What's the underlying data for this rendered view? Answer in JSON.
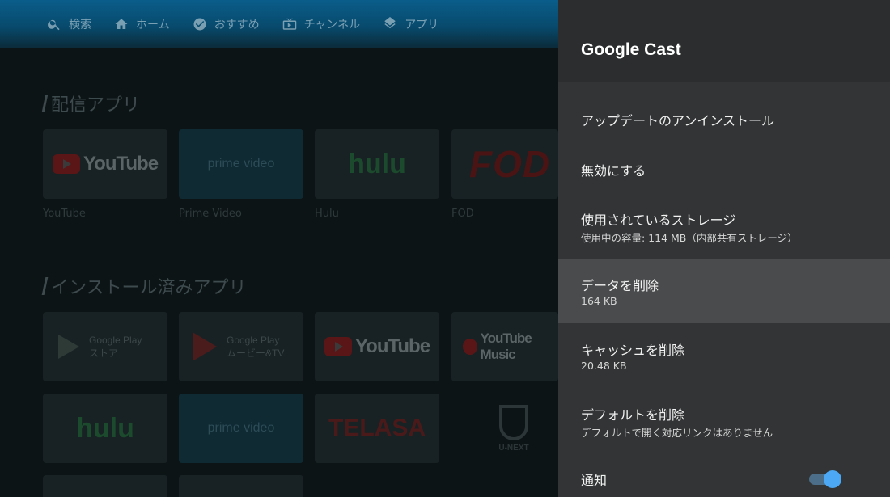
{
  "launcher": {
    "nav": [
      {
        "label": "検索",
        "icon": "search-icon"
      },
      {
        "label": "ホーム",
        "icon": "home-icon"
      },
      {
        "label": "おすすめ",
        "icon": "check-circle-icon"
      },
      {
        "label": "チャンネル",
        "icon": "tv-icon"
      },
      {
        "label": "アプリ",
        "icon": "layers-icon"
      }
    ],
    "sections": {
      "streaming_title": "配信アプリ",
      "installed_title": "インストール済みアプリ"
    },
    "streaming_apps": [
      {
        "logo": "YouTube",
        "caption": "YouTube"
      },
      {
        "logo": "prime video",
        "caption": "Prime Video"
      },
      {
        "logo": "hulu",
        "caption": "Hulu"
      },
      {
        "logo": "FOD",
        "caption": "FOD"
      }
    ],
    "installed_apps": [
      {
        "logo": "Google Play ストア"
      },
      {
        "logo": "Google Play ムービー&TV"
      },
      {
        "logo": "YouTube"
      },
      {
        "logo": "YouTube Music"
      },
      {
        "logo": "hulu"
      },
      {
        "logo": "prime video"
      },
      {
        "logo": "TELASA"
      },
      {
        "logo": "U-NEXT"
      }
    ]
  },
  "panel": {
    "title": "Google Cast",
    "items": [
      {
        "title": "アップデートのアンインストール"
      },
      {
        "title": "無効にする"
      },
      {
        "title": "使用されているストレージ",
        "subtitle": "使用中の容量: 114 MB（内部共有ストレージ）"
      },
      {
        "title": "データを削除",
        "subtitle": "164 KB"
      },
      {
        "title": "キャッシュを削除",
        "subtitle": "20.48 KB"
      },
      {
        "title": "デフォルトを削除",
        "subtitle": "デフォルトで開く対応リンクはありません"
      },
      {
        "title": "通知"
      }
    ],
    "notification_enabled": true,
    "toggle_color": "#4ca8f5"
  }
}
